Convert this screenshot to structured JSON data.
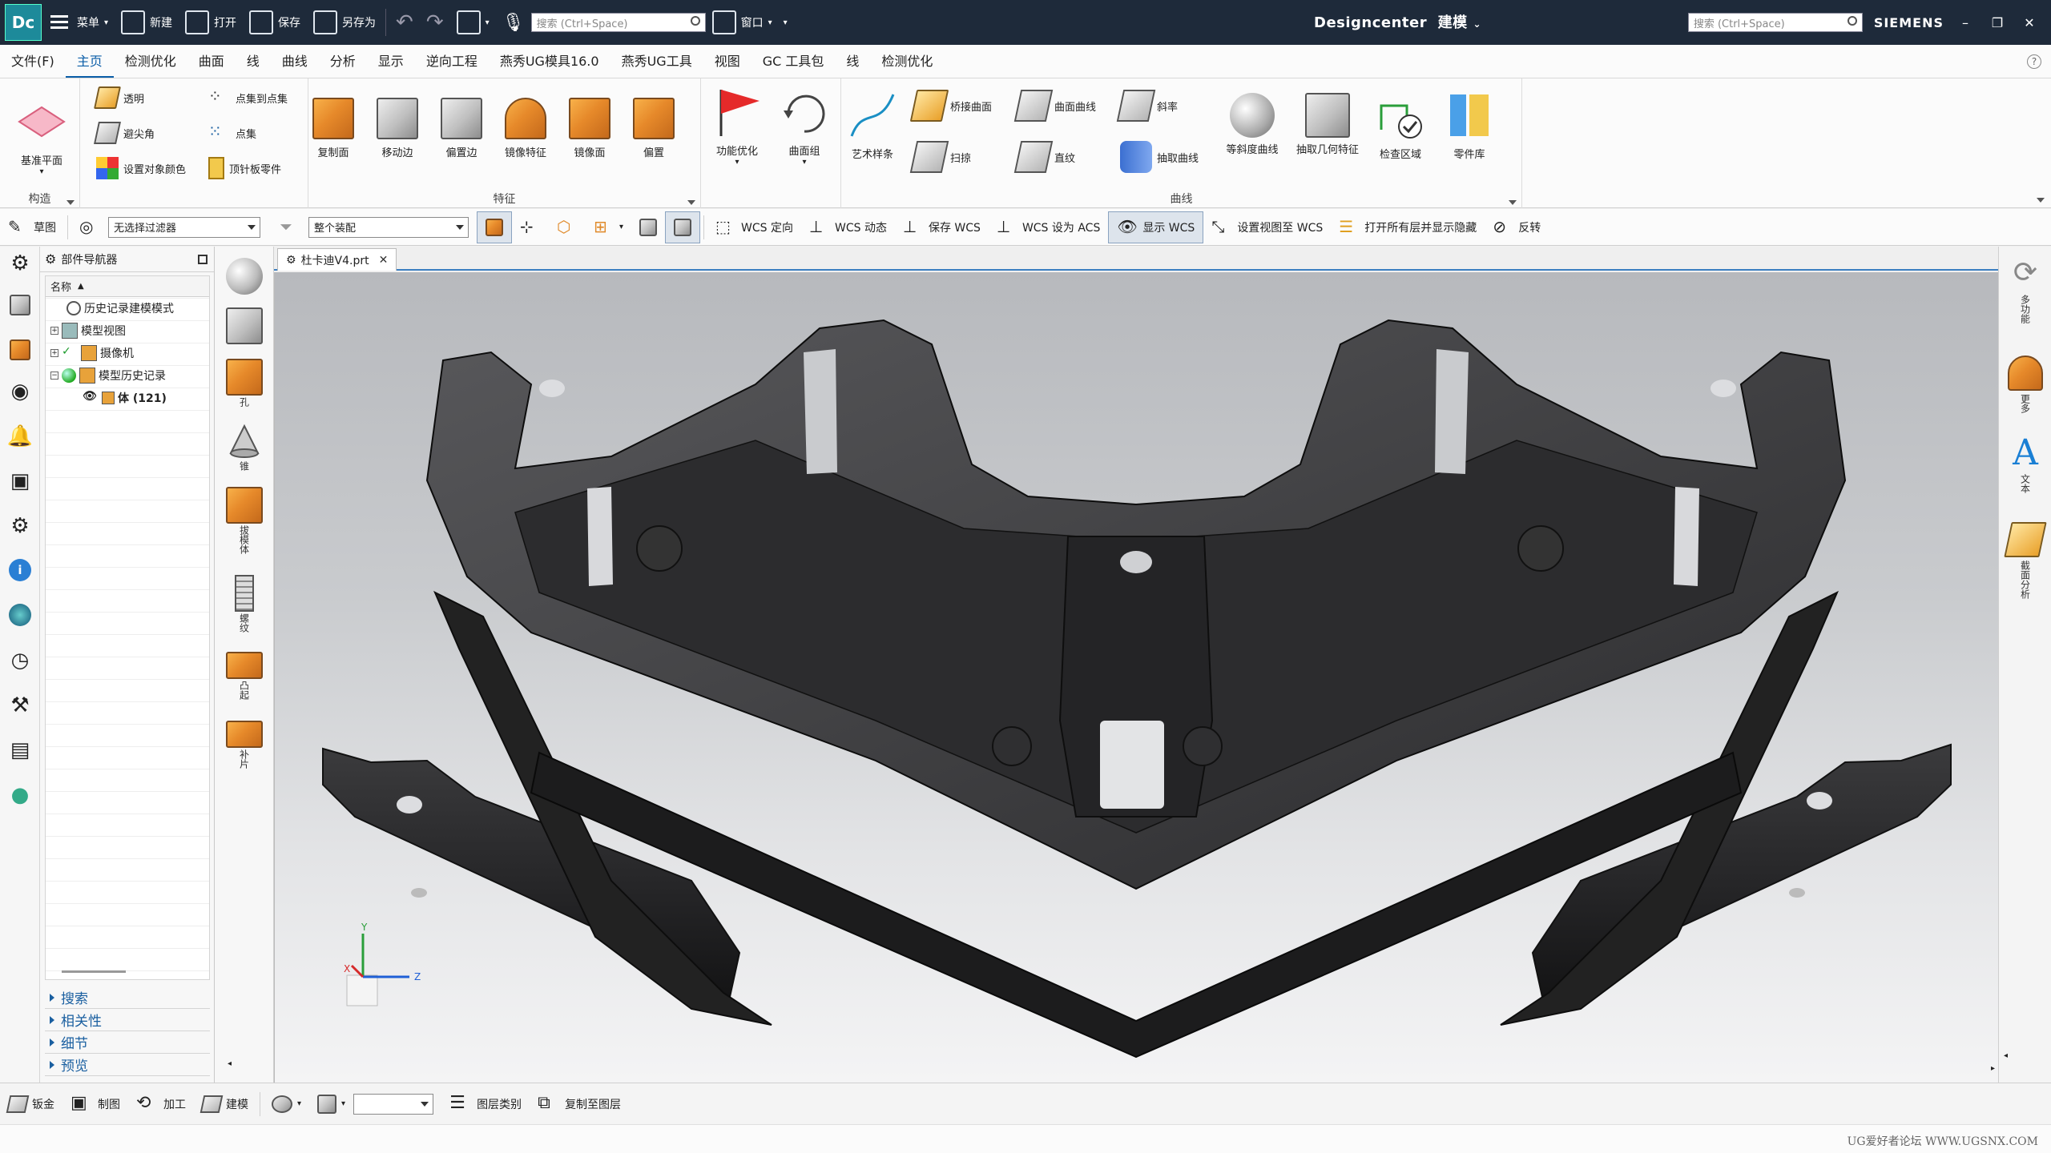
{
  "app": {
    "logo": "Dc",
    "title": "Designcenter",
    "mode": "建模",
    "brand": "SIEMENS",
    "accent": "#0b5ea8",
    "titlebar_bg": "#1e2a3a"
  },
  "quick_access": {
    "menu": "菜单",
    "new": "新建",
    "open": "打开",
    "save": "保存",
    "save_as": "另存为",
    "window": "窗口",
    "search_placeholder": "搜索 (Ctrl+Space)",
    "search_placeholder_right": "搜索 (Ctrl+Space)"
  },
  "menu_tabs": [
    "文件(F)",
    "主页",
    "检测优化",
    "曲面",
    "线",
    "曲线",
    "分析",
    "显示",
    "逆向工程",
    "燕秀UG模具16.0",
    "燕秀UG工具",
    "视图",
    "GC 工具包",
    "线",
    "检测优化"
  ],
  "active_tab_index": 1,
  "ribbon": {
    "group_construct": {
      "label": "构造",
      "datum_plane": "基准平面",
      "transparent": "透明",
      "avoid_corner": "避尖角",
      "set_color": "设置对象颜色",
      "point_to_point": "点集到点集",
      "point_set": "点集",
      "top_plate_part": "顶针板零件"
    },
    "group_feature": {
      "label": "特征",
      "copy_face": "复制面",
      "move_edge": "移动边",
      "offset_edge": "偏置边",
      "mirror_feature": "镜像特征",
      "mirror_face": "镜像面",
      "offset": "偏置",
      "optimize": "功能优化",
      "surface_group": "曲面组"
    },
    "group_curve": {
      "label": "曲线",
      "art_spline": "艺术样条",
      "bridge_surface": "桥接曲面",
      "sweep": "扫掠",
      "surface_curve": "曲面曲线",
      "ruled": "直纹",
      "slope": "斜率",
      "extract_curve": "抽取曲线",
      "isocline_curve": "等斜度曲线",
      "extract_geometry": "抽取几何特征",
      "check_region": "检查区域",
      "part_library": "零件库"
    }
  },
  "toolbar2": {
    "sketch": "草图",
    "filter_value": "无选择过滤器",
    "assembly_value": "整个装配",
    "wcs_orient": "WCS 定向",
    "wcs_dynamic": "WCS 动态",
    "save_wcs": "保存 WCS",
    "wcs_to_acs": "WCS 设为 ACS",
    "show_wcs": "显示 WCS",
    "set_view_to_wcs": "设置视图至 WCS",
    "open_layers": "打开所有层并显示隐藏",
    "invert": "反转"
  },
  "navigator": {
    "title": "部件导航器",
    "column_name": "名称",
    "rows": [
      {
        "label": "历史记录建模模式",
        "level": 1
      },
      {
        "label": "模型视图",
        "level": 0
      },
      {
        "label": "摄像机",
        "level": 0
      },
      {
        "label": "模型历史记录",
        "level": 0
      },
      {
        "label": "体 (121)",
        "level": 1
      }
    ],
    "panels": [
      "搜索",
      "相关性",
      "细节",
      "预览"
    ]
  },
  "shape_palette": {
    "hole": "孔",
    "cone": "锥",
    "extrude": "拔模体",
    "thread": "螺纹",
    "boss": "凸起",
    "patch": "补片"
  },
  "graphics": {
    "file_tab": "杜卡迪V4.prt",
    "axis_x": "X",
    "axis_y": "Y",
    "axis_z": "Z"
  },
  "right_dock": {
    "multifunction": "多功能",
    "more": "更多",
    "text_glyph": "A",
    "text": "文本",
    "section_analysis": "截面分析"
  },
  "status_bar": {
    "sheet_metal": "钣金",
    "drafting": "制图",
    "machining": "加工",
    "modeling": "建模",
    "layer_category": "图层类别",
    "copy_to_layer": "复制至图层"
  },
  "watermark": "UG爱好者论坛 WWW.UGSNX.COM"
}
